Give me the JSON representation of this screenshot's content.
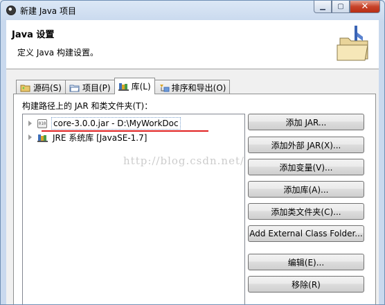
{
  "window": {
    "title": "新建 Java 项目",
    "min_glyph": "▁",
    "max_glyph": "▢",
    "close_glyph": "✕"
  },
  "header": {
    "title": "Java 设置",
    "description": "定义 Java 构建设置。"
  },
  "tabs": [
    {
      "label": "源码(S)",
      "icon": "source-folder-icon",
      "active": false
    },
    {
      "label": "项目(P)",
      "icon": "project-icon",
      "active": false
    },
    {
      "label": "库(L)",
      "icon": "library-icon",
      "active": true
    },
    {
      "label": "排序和导出(O)",
      "icon": "order-export-icon",
      "active": false
    }
  ],
  "panel": {
    "label": "构建路径上的 JAR 和类文件夹(T)："
  },
  "tree": [
    {
      "label": "core-3.0.0.jar  -  D:\\MyWorkDoc",
      "icon": "jar-icon",
      "jar_text": "010"
    },
    {
      "label": "JRE 系统库 [JavaSE-1.7]",
      "icon": "library-icon"
    }
  ],
  "buttons": [
    {
      "label": "添加 JAR..."
    },
    {
      "label": "添加外部 JAR(X)..."
    },
    {
      "label": "添加变量(V)..."
    },
    {
      "label": "添加库(A)..."
    },
    {
      "label": "添加类文件夹(C)..."
    },
    {
      "label": "Add External Class Folder..."
    },
    {
      "label": "编辑(E)..."
    },
    {
      "label": "移除(R)"
    }
  ],
  "watermark": "http://blog.csdn.net/",
  "colors": {
    "accent_underline": "#e02020",
    "close_button": "#c7432a"
  }
}
